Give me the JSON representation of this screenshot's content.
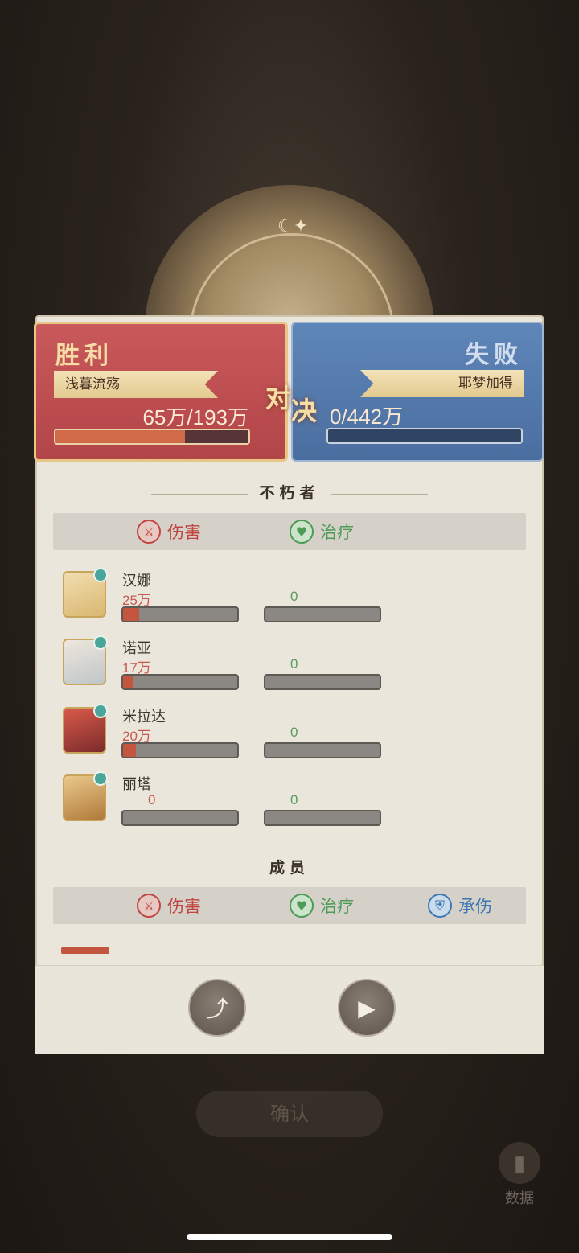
{
  "win": {
    "result": "胜利",
    "team": "浅暮流殇",
    "score": "65万/193万",
    "progress": 0.67
  },
  "lose": {
    "result": "失败",
    "team": "耶梦加得",
    "score": "0/442万",
    "progress": 0
  },
  "versus": {
    "left": "对",
    "right": "决"
  },
  "immortals": {
    "title": "不朽者",
    "tabs": {
      "damage": "伤害",
      "heal": "治疗"
    },
    "heroes": [
      {
        "name": "汉娜",
        "damage": "25万",
        "heal": "0",
        "damage_ratio": 0.14,
        "heal_ratio": 0
      },
      {
        "name": "诺亚",
        "damage": "17万",
        "heal": "0",
        "damage_ratio": 0.09,
        "heal_ratio": 0
      },
      {
        "name": "米拉达",
        "damage": "20万",
        "heal": "0",
        "damage_ratio": 0.11,
        "heal_ratio": 0
      },
      {
        "name": "丽塔",
        "damage": "0",
        "heal": "0",
        "damage_ratio": 0,
        "heal_ratio": 0
      }
    ]
  },
  "members": {
    "title": "成员",
    "tabs": {
      "damage": "伤害",
      "heal": "治疗",
      "tank": "承伤"
    }
  },
  "footer": {
    "confirm": "确认",
    "data": "数据"
  }
}
